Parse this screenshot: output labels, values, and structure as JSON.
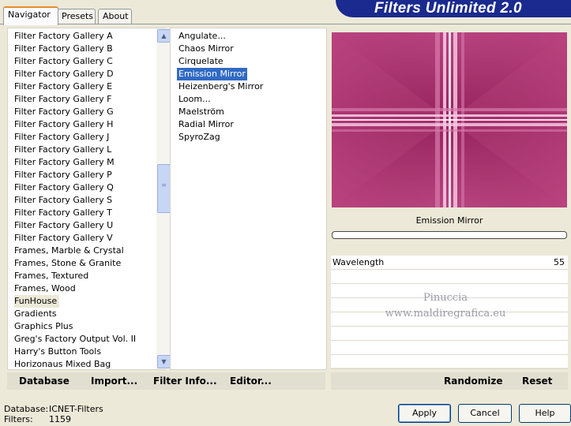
{
  "tabs": [
    {
      "label": "Navigator",
      "active": true
    },
    {
      "label": "Presets",
      "active": false
    },
    {
      "label": "About",
      "active": false
    }
  ],
  "title": "Filters Unlimited 2.0",
  "categories": [
    "Filter Factory Gallery A",
    "Filter Factory Gallery B",
    "Filter Factory Gallery C",
    "Filter Factory Gallery D",
    "Filter Factory Gallery E",
    "Filter Factory Gallery F",
    "Filter Factory Gallery G",
    "Filter Factory Gallery H",
    "Filter Factory Gallery J",
    "Filter Factory Gallery L",
    "Filter Factory Gallery M",
    "Filter Factory Gallery P",
    "Filter Factory Gallery Q",
    "Filter Factory Gallery S",
    "Filter Factory Gallery T",
    "Filter Factory Gallery U",
    "Filter Factory Gallery V",
    "Frames, Marble & Crystal",
    "Frames, Stone & Granite",
    "Frames, Textured",
    "Frames, Wood",
    "FunHouse",
    "Gradients",
    "Graphics Plus",
    "Greg's Factory Output Vol. II",
    "Harry's Button Tools",
    "Horizonaus Mixed Bag"
  ],
  "selected_category": "FunHouse",
  "filters": [
    "Angulate...",
    "Chaos Mirror",
    "Cirquelate",
    "Emission Mirror",
    "Heizenberg's Mirror",
    "Loom...",
    "Maelström",
    "Radial Mirror",
    "SpyroZag"
  ],
  "selected_filter": "Emission Mirror",
  "preview": {
    "filter_name": "Emission Mirror",
    "base_color": "#a62d6a",
    "highlight_color": "#f5c6e2"
  },
  "parameters": [
    {
      "label": "Wavelength",
      "value": "55"
    }
  ],
  "watermark": {
    "line1": "Pinuccia",
    "line2": "www.maldiregrafica.eu"
  },
  "bottom_left": {
    "database": "Database",
    "import": "Import...",
    "filter_info": "Filter Info...",
    "editor": "Editor..."
  },
  "bottom_right": {
    "randomize": "Randomize",
    "reset": "Reset"
  },
  "status": {
    "database_label": "Database:",
    "database_value": "ICNET-Filters",
    "filters_label": "Filters:",
    "filters_value": "1159"
  },
  "dialog": {
    "apply": "Apply",
    "cancel": "Cancel",
    "help": "Help"
  }
}
